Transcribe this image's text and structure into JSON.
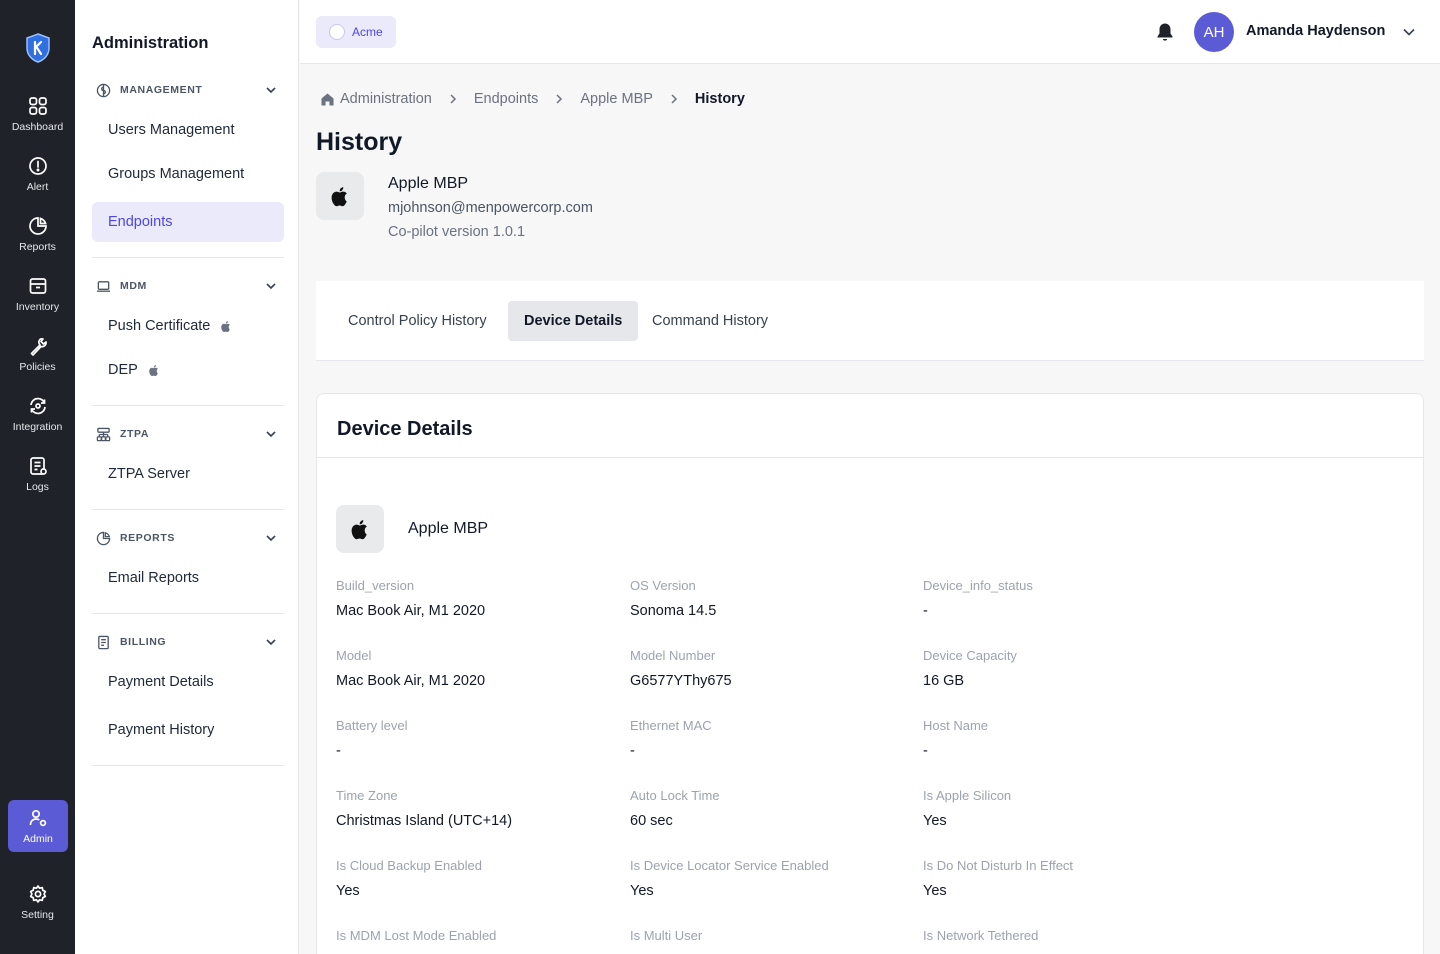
{
  "rail": {
    "items": [
      {
        "label": "Dashboard",
        "icon": "dashboard-icon"
      },
      {
        "label": "Alert",
        "icon": "alert-icon"
      },
      {
        "label": "Reports",
        "icon": "reports-icon"
      },
      {
        "label": "Inventory",
        "icon": "inventory-icon"
      },
      {
        "label": "Policies",
        "icon": "wrench-icon"
      },
      {
        "label": "Integration",
        "icon": "integration-icon"
      },
      {
        "label": "Logs",
        "icon": "logs-icon"
      }
    ],
    "admin_label": "Admin",
    "setting_label": "Setting"
  },
  "sidebar": {
    "title": "Administration",
    "sections": [
      {
        "label": "MANAGEMENT",
        "items": [
          "Users Management",
          "Groups Management",
          "Endpoints"
        ]
      },
      {
        "label": "MDM",
        "items": [
          "Push Certificate",
          "DEP"
        ]
      },
      {
        "label": "ZTPA",
        "items": [
          "ZTPA Server"
        ]
      },
      {
        "label": "REPORTS",
        "items": [
          "Email Reports"
        ]
      },
      {
        "label": "BILLING",
        "items": [
          "Payment Details",
          "Payment History"
        ]
      }
    ],
    "active_item": "Endpoints"
  },
  "topbar": {
    "org": "Acme",
    "avatar_initials": "AH",
    "user_name": "Amanda Haydenson"
  },
  "breadcrumb": [
    "Administration",
    "Endpoints",
    "Apple MBP",
    "History"
  ],
  "page": {
    "title": "History",
    "device_name": "Apple MBP",
    "device_email": "mjohnson@menpowercorp.com",
    "device_version": "Co-pilot version 1.0.1"
  },
  "tabs": [
    "Control Policy History",
    "Device Details",
    "Command History"
  ],
  "active_tab": "Device Details",
  "details": {
    "title": "Device Details",
    "device_name": "Apple MBP",
    "fields": [
      {
        "label": "Build_version",
        "value": "Mac Book Air, M1 2020"
      },
      {
        "label": "OS Version",
        "value": "Sonoma 14.5"
      },
      {
        "label": "Device_info_status",
        "value": "-"
      },
      {
        "label": "Model",
        "value": "Mac Book Air, M1 2020"
      },
      {
        "label": "Model Number",
        "value": "G6577YThy675"
      },
      {
        "label": "Device Capacity",
        "value": "16 GB"
      },
      {
        "label": "Battery level",
        "value": "-"
      },
      {
        "label": "Ethernet MAC",
        "value": "-"
      },
      {
        "label": "Host Name",
        "value": "-"
      },
      {
        "label": "Time Zone",
        "value": "Christmas Island (UTC+14)"
      },
      {
        "label": "Auto Lock Time",
        "value": "60 sec"
      },
      {
        "label": "Is Apple Silicon",
        "value": "Yes"
      },
      {
        "label": "Is Cloud Backup Enabled",
        "value": "Yes"
      },
      {
        "label": "Is Device Locator Service Enabled",
        "value": "Yes"
      },
      {
        "label": "Is Do Not Disturb In Effect",
        "value": "Yes"
      },
      {
        "label": "Is MDM Lost Mode Enabled",
        "value": ""
      },
      {
        "label": "Is Multi User",
        "value": ""
      },
      {
        "label": "Is Network Tethered",
        "value": ""
      }
    ]
  },
  "colors": {
    "rail_bg": "#1f2329",
    "accent": "#5b5bd6",
    "active_bg": "#eaeafb",
    "page_bg": "#f7f7f8"
  }
}
